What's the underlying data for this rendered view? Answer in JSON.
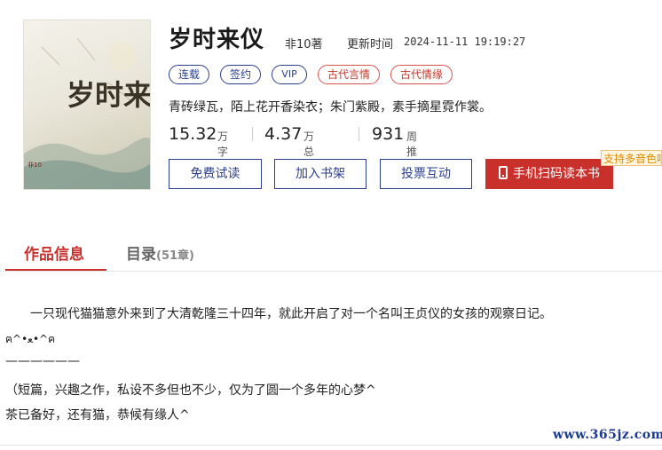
{
  "book": {
    "title": "岁时来仪",
    "author": "非10著",
    "update_label": "更新时间",
    "update_time": "2024-11-11 19:19:27",
    "intro": "青砖绿瓦，陌上花开香染衣；朱门紫殿，素手摘星霓作裳。"
  },
  "cover": {
    "title_art": "岁时来仪",
    "imprint": "非10"
  },
  "tags": [
    {
      "label": "连载",
      "style": "blue"
    },
    {
      "label": "签约",
      "style": "blue"
    },
    {
      "label": "VIP",
      "style": "blue"
    },
    {
      "label": "古代言情",
      "style": "red"
    },
    {
      "label": "古代情缘",
      "style": "red"
    }
  ],
  "stats": [
    {
      "value": "15.32",
      "unit": "万字"
    },
    {
      "value": "4.37",
      "unit": "万总推荐"
    },
    {
      "value": "931",
      "unit": "周推荐"
    }
  ],
  "buttons": {
    "free_read": "免费试读",
    "add_shelf": "加入书架",
    "vote": "投票互动",
    "scan_read": "手机扫码读本书",
    "badge": "支持多音色听书"
  },
  "tabs": {
    "info": "作品信息",
    "catalog": "目录",
    "catalog_count": "(51章)"
  },
  "description": [
    "　　一只现代猫猫意外来到了大清乾隆三十四年，就此开启了对一个名叫王贞仪的女孩的观察日记。",
    "ฅ^•ﻌ•^ฅ",
    "——————",
    "（短篇，兴趣之作，私设不多但也不少，仅为了圆一个多年的心梦^",
    "茶已备好，还有猫，恭候有缘人^"
  ],
  "watermark": "www.365jz.com",
  "colors": {
    "accent_red": "#c9302c",
    "accent_blue": "#2a3f8f",
    "badge_orange": "#e08a00"
  }
}
